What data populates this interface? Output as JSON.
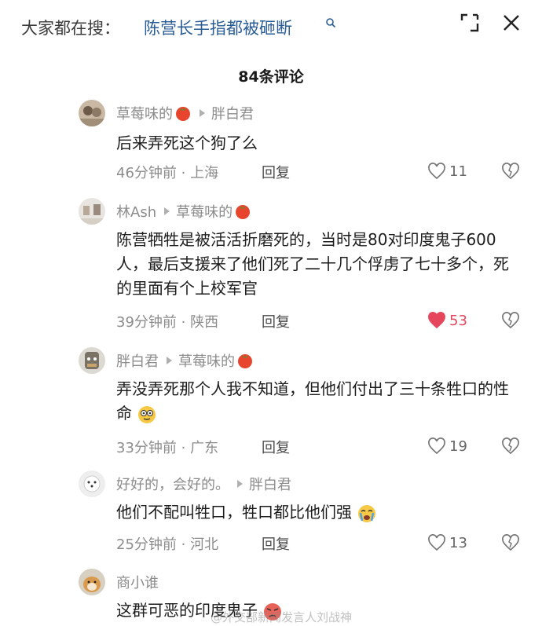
{
  "search": {
    "prefix": "大家都在搜：",
    "query": "陈营长手指都被砸断"
  },
  "header": {
    "comment_count": "84条评论"
  },
  "comments": [
    {
      "author": "草莓味的",
      "reply_to": "胖白君",
      "text": "后来弄死这个狗了么",
      "time_location": "46分钟前 · 上海",
      "reply_label": "回复",
      "likes": "11",
      "liked": false
    },
    {
      "author": "林Ash",
      "reply_to": "草莓味的",
      "text": "陈营牺牲是被活活折磨死的，当时是80对印度鬼子600人，最后支援来了他们死了二十几个俘虏了七十多个，死的里面有个上校军官",
      "time_location": "39分钟前 · 陕西",
      "reply_label": "回复",
      "likes": "53",
      "liked": true
    },
    {
      "author": "胖白君",
      "reply_to": "草莓味的",
      "text": "弄没弄死那个人我不知道，但他们付出了三十条牲口的性命",
      "time_location": "33分钟前 · 广东",
      "reply_label": "回复",
      "likes": "19",
      "liked": false
    },
    {
      "author": "好好的，会好的。",
      "reply_to": "胖白君",
      "text": "他们不配叫牲口，牲口都比他们强",
      "time_location": "25分钟前 · 河北",
      "reply_label": "回复",
      "likes": "13",
      "liked": false
    },
    {
      "author": "商小谁",
      "reply_to": "",
      "text": "这群可恶的印度鬼子",
      "time_location": "",
      "reply_label": "",
      "likes": "",
      "liked": false
    }
  ],
  "watermark": "@外交部新闻发言人刘战神",
  "colors": {
    "link_blue": "#2a5d95",
    "like_red": "#e5465b",
    "muted": "#8c8c8c"
  },
  "icons": [
    "search-icon",
    "expand-icon",
    "close-icon",
    "tomato-emoji",
    "reply-arrow-icon",
    "heart-icon",
    "broken-heart-icon",
    "peek-emoji",
    "crying-emoji"
  ]
}
